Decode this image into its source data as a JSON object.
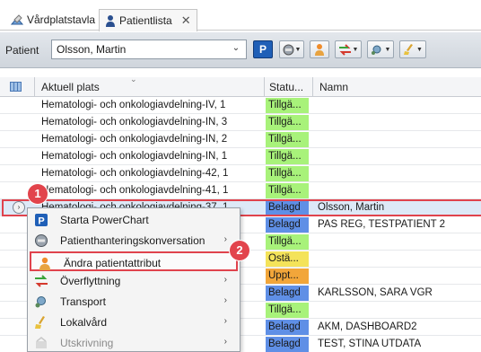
{
  "tabs": [
    {
      "label": "Vårdplatstavla",
      "icon": "board-icon"
    },
    {
      "label": "Patientlista",
      "icon": "person-icon",
      "close": "✕"
    }
  ],
  "toolbar": {
    "patient_label": "Patient",
    "patient_value": "Olsson, Martin",
    "buttons": [
      "powerchart-p-button",
      "view-dropdown",
      "patient-action-button",
      "transfer-dropdown",
      "transport-dropdown",
      "cleaning-dropdown"
    ]
  },
  "columns": {
    "place": "Aktuell plats",
    "status": "Statu...",
    "name": "Namn"
  },
  "status_colors": {
    "Tillgä...": "#a8f27a",
    "Belagd": "#5f8fe6",
    "Ostä...": "#f4e35a",
    "Uppt...": "#f2a63a"
  },
  "rows": [
    {
      "place": "Hematologi- och onkologiavdelning-IV, 1",
      "status": "Tillgä...",
      "name": ""
    },
    {
      "place": "Hematologi- och onkologiavdelning-IN, 3",
      "status": "Tillgä...",
      "name": ""
    },
    {
      "place": "Hematologi- och onkologiavdelning-IN, 2",
      "status": "Tillgä...",
      "name": ""
    },
    {
      "place": "Hematologi- och onkologiavdelning-IN, 1",
      "status": "Tillgä...",
      "name": ""
    },
    {
      "place": "Hematologi- och onkologiavdelning-42, 1",
      "status": "Tillgä...",
      "name": ""
    },
    {
      "place": "Hematologi- och onkologiavdelning-41, 1",
      "status": "Tillgä...",
      "name": ""
    },
    {
      "place": "Hematologi- och onkologiavdelning-37, 1",
      "status": "Belagd",
      "name": "Olsson, Martin"
    },
    {
      "place": "",
      "status": "Belagd",
      "name": "PAS REG, TESTPATIENT 2"
    },
    {
      "place": "",
      "status": "Tillgä...",
      "name": ""
    },
    {
      "place": "",
      "status": "Ostä...",
      "name": ""
    },
    {
      "place": "",
      "status": "Uppt...",
      "name": ""
    },
    {
      "place": "",
      "status": "Belagd",
      "name": "KARLSSON, SARA VGR"
    },
    {
      "place": "",
      "status": "Tillgä...",
      "name": ""
    },
    {
      "place": "",
      "status": "Belagd",
      "name": "AKM, DASHBOARD2"
    },
    {
      "place": "",
      "status": "Belagd",
      "name": "TEST, STINA UTDATA"
    }
  ],
  "context_menu": [
    {
      "label": "Starta PowerChart",
      "icon": "powerchart-icon",
      "submenu": false,
      "disabled": false
    },
    {
      "label": "Patienthanteringskonversation",
      "icon": "conversation-icon",
      "submenu": true,
      "disabled": false
    },
    {
      "label": "Ändra patientattribut",
      "icon": "edit-patient-icon",
      "submenu": false,
      "disabled": false
    },
    {
      "label": "Överflyttning",
      "icon": "transfer-icon",
      "submenu": true,
      "disabled": false
    },
    {
      "label": "Transport",
      "icon": "transport-icon",
      "submenu": true,
      "disabled": false
    },
    {
      "label": "Lokalvård",
      "icon": "cleaning-icon",
      "submenu": true,
      "disabled": false
    },
    {
      "label": "Utskrivning",
      "icon": "discharge-icon",
      "submenu": true,
      "disabled": true
    }
  ],
  "callouts": [
    "1",
    "2"
  ]
}
